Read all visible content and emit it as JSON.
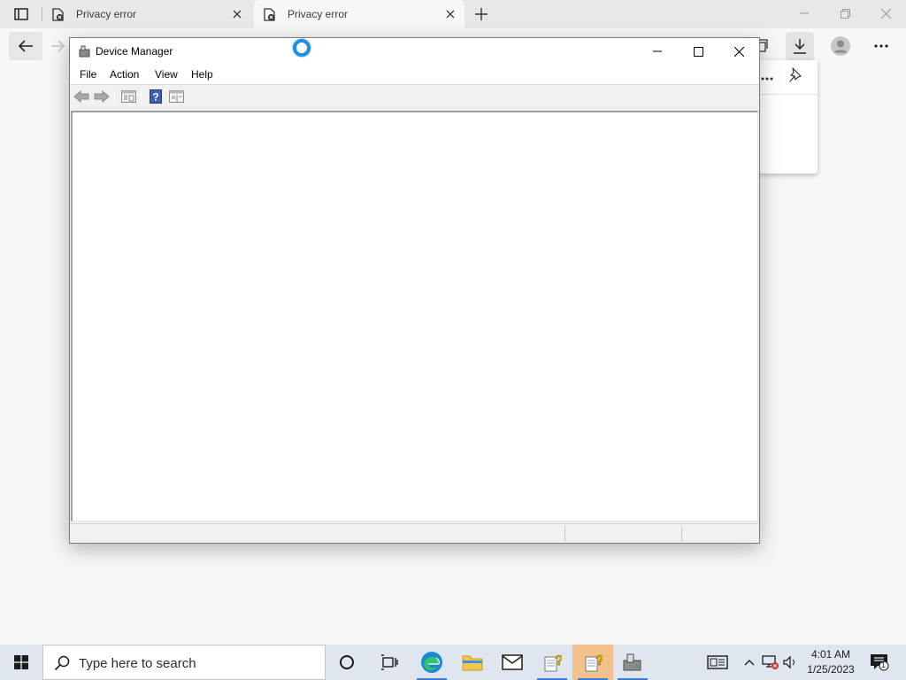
{
  "browser": {
    "tabs": [
      {
        "title": "Privacy error",
        "active": false
      },
      {
        "title": "Privacy error",
        "active": true
      }
    ]
  },
  "device_manager": {
    "title": "Device Manager",
    "menu": [
      "File",
      "Action",
      "View",
      "Help"
    ],
    "toolbar_icons": [
      "back-arrow-icon",
      "forward-arrow-icon",
      "properties-icon",
      "help-icon",
      "console-tree-icon"
    ]
  },
  "taskbar": {
    "search_placeholder": "Type here to search",
    "time": "4:01 AM",
    "date": "1/25/2023",
    "notification_count": "1"
  },
  "colors": {
    "taskbar_bg": "#dfe6ef",
    "active_app": "#f4c08e",
    "accent": "#1f8fe0"
  }
}
